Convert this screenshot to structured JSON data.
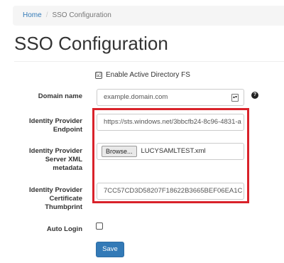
{
  "breadcrumb": {
    "home": "Home",
    "separator": "/",
    "current": "SSO Configuration"
  },
  "page": {
    "title": "SSO Configuration"
  },
  "form": {
    "enable_ad_fs": {
      "label": "Enable Active Directory FS",
      "checked": true,
      "check_glyph": "☑"
    },
    "domain_name": {
      "label": "Domain name",
      "value": "example.domain.com",
      "help_glyph": "?"
    },
    "idp_endpoint": {
      "label_line1": "Identity Provider",
      "label_line2": "Endpoint",
      "value": "https://sts.windows.net/3bbcfb24-8c96-4831-a"
    },
    "idp_metadata": {
      "label_line1": "Identity Provider",
      "label_line2": "Server XML",
      "label_line3": "metadata",
      "browse_label": "Browse...",
      "file_name": "LUCYSAMLTEST.xml"
    },
    "idp_thumbprint": {
      "label_line1": "Identity Provider",
      "label_line2": "Certificate",
      "label_line3": "Thumbprint",
      "value": "7CC57CD3D58207F18622B3665BEF06EA1C"
    },
    "auto_login": {
      "label": "Auto Login",
      "checked": false
    },
    "save_label": "Save"
  },
  "colors": {
    "highlight_border": "#d9222a",
    "primary": "#337ab7",
    "link": "#337ab7"
  },
  "icons": {
    "help": "question-circle-icon",
    "stepper": "stepper-icon",
    "checkbox": "checkbox-icon"
  }
}
